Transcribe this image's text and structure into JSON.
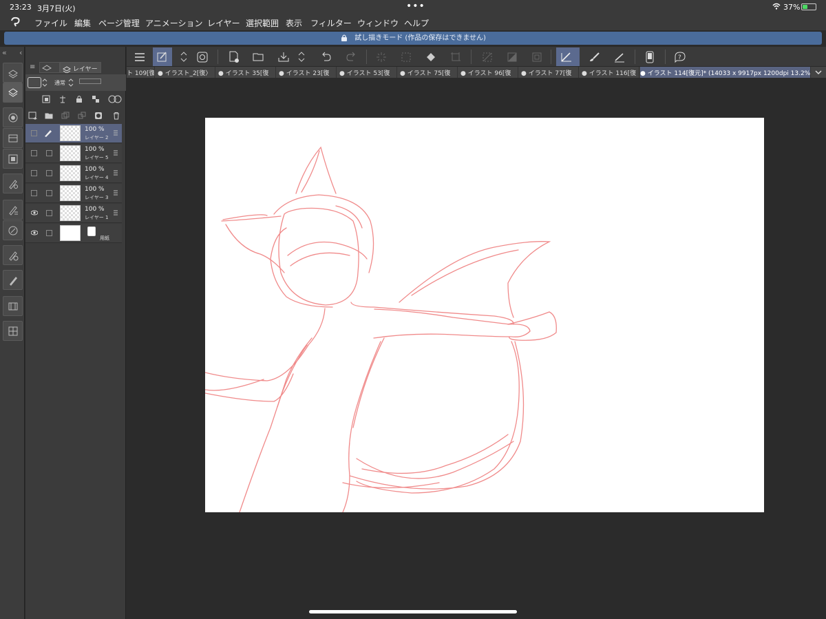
{
  "status_bar": {
    "time": "23:23",
    "date": "3月7日(火)",
    "dots": "•••",
    "battery": "37%",
    "battery_level": 0.37
  },
  "menu": {
    "items": [
      "ファイル",
      "編集",
      "ページ管理",
      "アニメーション",
      "レイヤー",
      "選択範囲",
      "表示",
      "フィルター",
      "ウィンドウ",
      "ヘルプ"
    ]
  },
  "trial_banner": "試し描きモード (作品の保存はできません)",
  "layer_panel": {
    "tab_label": "レイヤー",
    "blend_mode": "通常",
    "layers": [
      {
        "opacity": "100 %",
        "name": "レイヤー 2",
        "visible": false,
        "editing": true,
        "selected": true
      },
      {
        "opacity": "100 %",
        "name": "レイヤー 5",
        "visible": false,
        "editing": false,
        "selected": false
      },
      {
        "opacity": "100 %",
        "name": "レイヤー 4",
        "visible": false,
        "editing": false,
        "selected": false
      },
      {
        "opacity": "100 %",
        "name": "レイヤー 3",
        "visible": false,
        "editing": false,
        "selected": false
      },
      {
        "opacity": "100 %",
        "name": "レイヤー 1",
        "visible": true,
        "editing": false,
        "selected": false
      }
    ],
    "paper_layer": {
      "name": "用紙",
      "visible": true
    }
  },
  "tabs": [
    "ト 109[復",
    "● イラスト_2[復〉",
    "● イラスト 35[復",
    "● イラスト 23[復",
    "● イラスト 53[復",
    "● イラスト 75[復",
    "● イラスト 96[復",
    "● イラスト 77[復",
    "● イラスト 116[復",
    "● イラスト 114[復元]* (14033 x 9917px 1200dpi 13.2%)"
  ],
  "colors": {
    "accent": "#5b6a8f",
    "banner": "#4a6c9b",
    "sketch_line": "#f08a8a"
  }
}
